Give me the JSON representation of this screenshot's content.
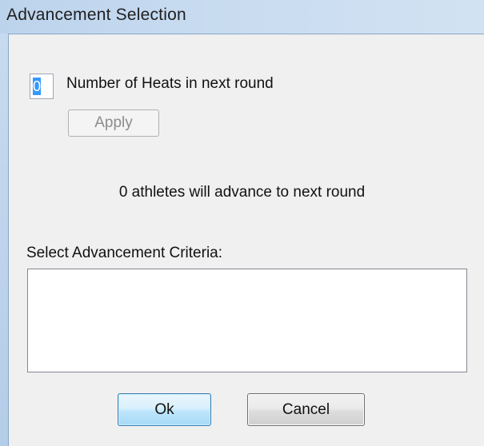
{
  "window": {
    "title": "Advancement Selection"
  },
  "heats": {
    "value": "0",
    "label": "Number of Heats in next round"
  },
  "buttons": {
    "apply": "Apply",
    "ok": "Ok",
    "cancel": "Cancel"
  },
  "advance_message": "0 athletes will advance to next round",
  "criteria": {
    "label": "Select Advancement Criteria:",
    "items": []
  },
  "colors": {
    "titlebar": "#bcd3ec",
    "client_bg": "#f0f0f0",
    "selection": "#3399ff",
    "ok_border": "#3c7fb1"
  }
}
